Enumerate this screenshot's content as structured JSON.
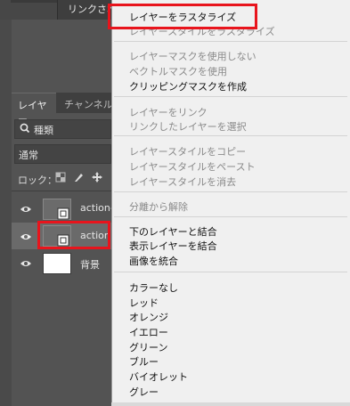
{
  "top_panel": {
    "link_text": "リンクされ"
  },
  "layers_panel": {
    "tabs": [
      {
        "label": "レイヤー"
      },
      {
        "label": "チャンネル"
      }
    ],
    "filter": {
      "value": "種類"
    },
    "blend_mode": {
      "value": "通常"
    },
    "lock_label": "ロック：",
    "layers": [
      {
        "name": "action-",
        "selected": false
      },
      {
        "name": "action",
        "selected": true
      },
      {
        "name": "背景",
        "selected": false
      }
    ]
  },
  "context_menu": {
    "items": [
      {
        "label": "レイヤーをラスタライズ",
        "enabled": true
      },
      {
        "label": "レイヤースタイルをラスタライズ",
        "enabled": false
      },
      {
        "label": "レイヤーマスクを使用しない",
        "enabled": false
      },
      {
        "label": "ベクトルマスクを使用",
        "enabled": false
      },
      {
        "label": "クリッピングマスクを作成",
        "enabled": true
      },
      {
        "label": "レイヤーをリンク",
        "enabled": false
      },
      {
        "label": "リンクしたレイヤーを選択",
        "enabled": false
      },
      {
        "label": "レイヤースタイルをコピー",
        "enabled": false
      },
      {
        "label": "レイヤースタイルをペースト",
        "enabled": false
      },
      {
        "label": "レイヤースタイルを消去",
        "enabled": false
      },
      {
        "label": "分離から解除",
        "enabled": false
      },
      {
        "label": "下のレイヤーと結合",
        "enabled": true
      },
      {
        "label": "表示レイヤーを結合",
        "enabled": true
      },
      {
        "label": "画像を統合",
        "enabled": true
      },
      {
        "label": "カラーなし",
        "enabled": true
      },
      {
        "label": "レッド",
        "enabled": true
      },
      {
        "label": "オレンジ",
        "enabled": true
      },
      {
        "label": "イエロー",
        "enabled": true
      },
      {
        "label": "グリーン",
        "enabled": true
      },
      {
        "label": "ブルー",
        "enabled": true
      },
      {
        "label": "バイオレット",
        "enabled": true
      },
      {
        "label": "グレー",
        "enabled": true
      }
    ]
  },
  "colors": {
    "highlight": "#e8141c",
    "panel_bg": "#535353",
    "menu_bg": "#f0f0f0"
  }
}
